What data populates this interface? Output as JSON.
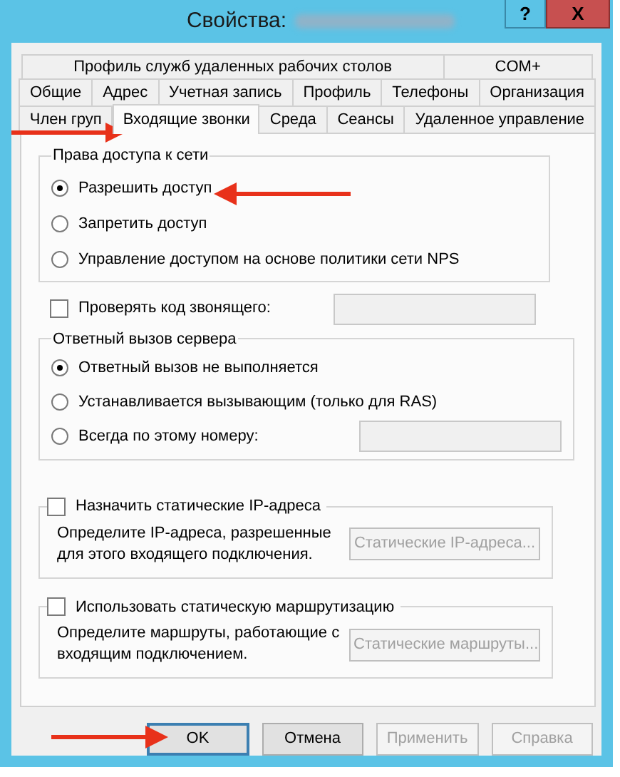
{
  "window": {
    "title": "Свойства:",
    "help_button": "?",
    "close_button": "X"
  },
  "tab_rows": [
    [
      {
        "label": "Профиль служб удаленных рабочих столов",
        "selected": false
      },
      {
        "label": "COM+",
        "selected": false
      }
    ],
    [
      {
        "label": "Общие",
        "selected": false
      },
      {
        "label": "Адрес",
        "selected": false
      },
      {
        "label": "Учетная запись",
        "selected": false
      },
      {
        "label": "Профиль",
        "selected": false
      },
      {
        "label": "Телефоны",
        "selected": false
      },
      {
        "label": "Организация",
        "selected": false
      }
    ],
    [
      {
        "label": "Член груп",
        "selected": false
      },
      {
        "label": "Входящие звонки",
        "selected": true
      },
      {
        "label": "Среда",
        "selected": false
      },
      {
        "label": "Сеансы",
        "selected": false
      },
      {
        "label": "Удаленное управление",
        "selected": false
      }
    ]
  ],
  "network_access": {
    "title": "Права доступа к сети",
    "options": [
      {
        "label": "Разрешить доступ",
        "selected": true
      },
      {
        "label": "Запретить доступ",
        "selected": false
      },
      {
        "label": "Управление доступом на основе политики сети NPS",
        "selected": false
      }
    ]
  },
  "verify_caller_id": {
    "label": "Проверять код звонящего:",
    "checked": false
  },
  "callback": {
    "title": "Ответный вызов сервера",
    "options": [
      {
        "label": "Ответный вызов не выполняется",
        "selected": true
      },
      {
        "label": "Устанавливается вызывающим (только для RAS)",
        "selected": false
      },
      {
        "label": "Всегда по этому номеру:",
        "selected": false,
        "has_field": true
      }
    ]
  },
  "static_ip": {
    "label": "Назначить статические IP-адреса",
    "checked": false,
    "description": "Определите IP-адреса, разрешенные для этого входящего подключения.",
    "button": {
      "label": "Статические IP-адреса...",
      "disabled": true
    }
  },
  "static_routes": {
    "label": "Использовать статическую маршрутизацию",
    "checked": false,
    "description": "Определите маршруты, работающие с  входящим подключением.",
    "button": {
      "label": "Статические маршруты...",
      "disabled": true
    }
  },
  "buttons": [
    {
      "label": "OK",
      "default": true,
      "disabled": false
    },
    {
      "label": "Отмена",
      "default": false,
      "disabled": false
    },
    {
      "label": "Применить",
      "default": false,
      "disabled": true
    },
    {
      "label": "Справка",
      "default": false,
      "disabled": true
    }
  ]
}
